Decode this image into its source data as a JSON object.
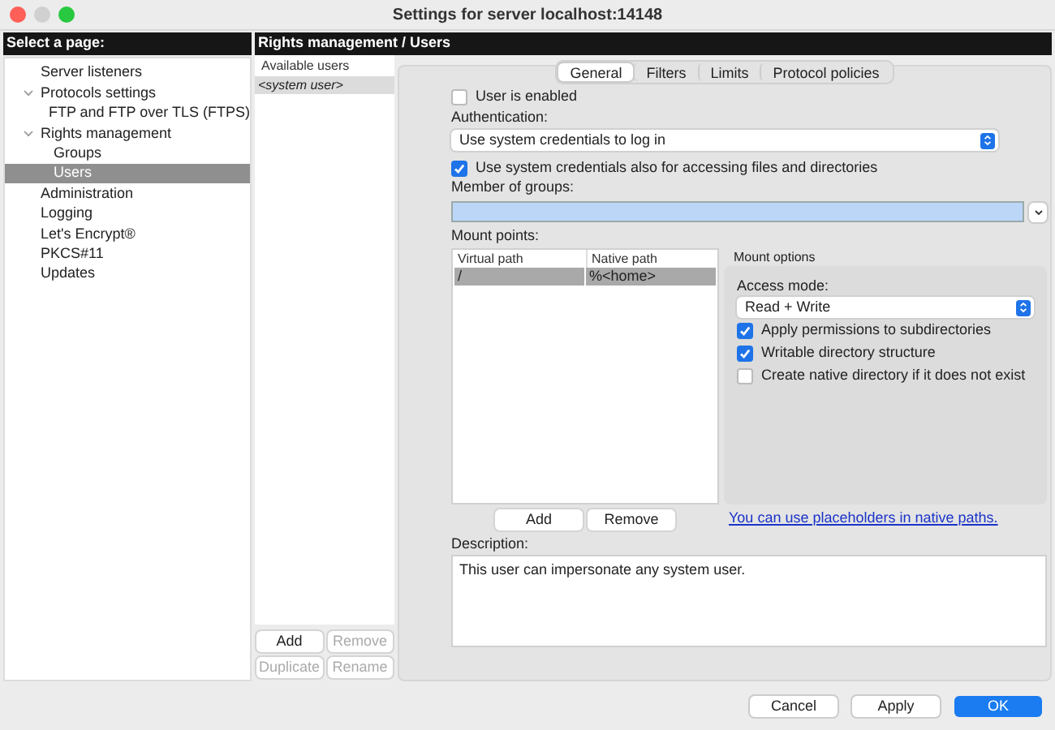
{
  "window": {
    "title": "Settings for server localhost:14148"
  },
  "sidebar": {
    "header": "Select a page:",
    "items": [
      {
        "label": "Server listeners",
        "selected": false
      },
      {
        "label": "Protocols settings",
        "selected": false,
        "expanded": true,
        "children": [
          {
            "label": "FTP and FTP over TLS (FTPS)",
            "selected": false
          }
        ]
      },
      {
        "label": "Rights management",
        "selected": false,
        "expanded": true,
        "children": [
          {
            "label": "Groups",
            "selected": false
          },
          {
            "label": "Users",
            "selected": true
          }
        ]
      },
      {
        "label": "Administration",
        "selected": false
      },
      {
        "label": "Logging",
        "selected": false
      },
      {
        "label": "Let's Encrypt®",
        "selected": false
      },
      {
        "label": "PKCS#11",
        "selected": false
      },
      {
        "label": "Updates",
        "selected": false
      }
    ]
  },
  "page_header": "Rights management / Users",
  "users": {
    "header": "Available users",
    "items": [
      {
        "label": "<system user>",
        "selected": true
      }
    ],
    "buttons": [
      {
        "label": "Add",
        "disabled": false
      },
      {
        "label": "Remove",
        "disabled": true
      },
      {
        "label": "Duplicate",
        "disabled": true
      },
      {
        "label": "Rename",
        "disabled": true
      }
    ]
  },
  "tabs": [
    {
      "label": "General",
      "selected": true
    },
    {
      "label": "Filters",
      "selected": false
    },
    {
      "label": "Limits",
      "selected": false
    },
    {
      "label": "Protocol policies",
      "selected": false
    }
  ],
  "user_enabled": {
    "label": "User is enabled",
    "checked": false
  },
  "authentication": {
    "label": "Authentication:",
    "value": "Use system credentials to log in"
  },
  "system_credentials": {
    "label": "Use system credentials also for accessing files and directories",
    "checked": true
  },
  "groups": {
    "label": "Member of groups:"
  },
  "mount_points": {
    "label": "Mount points:",
    "columns": [
      "Virtual path",
      "Native path"
    ],
    "rows": [
      {
        "cells": [
          "/",
          "%<home>"
        ],
        "selected": true
      }
    ],
    "buttons": [
      "Add",
      "Remove"
    ],
    "link": "You can use placeholders in native paths."
  },
  "mount_options": {
    "title": "Mount options",
    "access_label": "Access mode:",
    "access_value": "Read + Write",
    "options": [
      {
        "label": "Apply permissions to subdirectories",
        "checked": true
      },
      {
        "label": "Writable directory structure",
        "checked": true
      },
      {
        "label": "Create native directory if it does not exist",
        "checked": false
      }
    ]
  },
  "description": {
    "label": "Description:",
    "value": "This user can impersonate any system user."
  },
  "dialog_buttons": [
    {
      "label": "Cancel",
      "primary": false
    },
    {
      "label": "Apply",
      "primary": false
    },
    {
      "label": "OK",
      "primary": true
    }
  ]
}
